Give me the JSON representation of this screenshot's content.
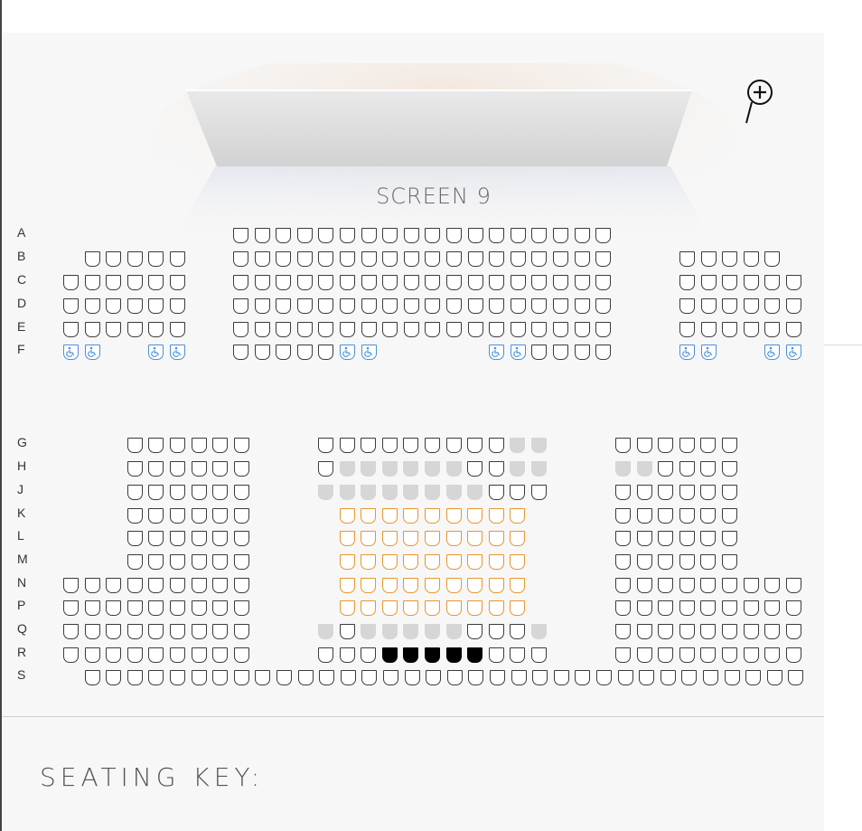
{
  "screen": {
    "label": "SCREEN 9"
  },
  "zoom": {
    "icon": "zoom-in-icon"
  },
  "seating_key": {
    "title": "SEATING KEY:"
  },
  "colors": {
    "available_border": "#3b3b3b",
    "sold": "#d6d6d6",
    "vip_border": "#e8962c",
    "selected": "#000000",
    "wheelchair": "#4a90d9"
  },
  "legend_states": [
    "available",
    "sold",
    "vip",
    "selected",
    "wheelchair"
  ],
  "rows": [
    {
      "label": "A",
      "blocks": [
        {
          "block": "center",
          "start": 0,
          "seats": "AAAAAAAAAAAAAAAAAA"
        }
      ]
    },
    {
      "label": "B",
      "blocks": [
        {
          "block": "left",
          "start": 1,
          "seats": "AAAAA"
        },
        {
          "block": "center",
          "start": 0,
          "seats": "AAAAAAAAAAAAAAAAAA"
        },
        {
          "block": "right",
          "start": 0,
          "seats": "AAAAA"
        }
      ]
    },
    {
      "label": "C",
      "blocks": [
        {
          "block": "left",
          "start": 0,
          "seats": "AAAAAA"
        },
        {
          "block": "center",
          "start": 0,
          "seats": "AAAAAAAAAAAAAAAAAA"
        },
        {
          "block": "right",
          "start": 0,
          "seats": "AAAAAA"
        }
      ]
    },
    {
      "label": "D",
      "blocks": [
        {
          "block": "left",
          "start": 0,
          "seats": "AAAAAA"
        },
        {
          "block": "center",
          "start": 0,
          "seats": "AAAAAAAAAAAAAAAAAA"
        },
        {
          "block": "right",
          "start": 0,
          "seats": "AAAAAA"
        }
      ]
    },
    {
      "label": "E",
      "blocks": [
        {
          "block": "left",
          "start": 0,
          "seats": "AAAAAA"
        },
        {
          "block": "center",
          "start": 0,
          "seats": "AAAAAAAAAAAAAAAAAA"
        },
        {
          "block": "right",
          "start": 0,
          "seats": "AAAAAA"
        }
      ]
    },
    {
      "label": "F",
      "blocks": [
        {
          "block": "left",
          "start": 0,
          "seats": "WW..WW"
        },
        {
          "block": "center",
          "start": 0,
          "seats": "AAAAAWW.....WWAAAA"
        },
        {
          "block": "right",
          "start": 0,
          "seats": "WW..WW"
        }
      ]
    },
    {
      "label": "G",
      "blocks": [
        {
          "block": "lower-left",
          "start": 3,
          "seats": "AAAAAA"
        },
        {
          "block": "lower-center",
          "start": 0,
          "seats": "AAAAAAAAASS"
        },
        {
          "block": "lower-right",
          "start": 0,
          "seats": "AAAAAA"
        }
      ]
    },
    {
      "label": "H",
      "blocks": [
        {
          "block": "lower-left",
          "start": 3,
          "seats": "AAAAAA"
        },
        {
          "block": "lower-center",
          "start": 0,
          "seats": "ASSSSSSAASS"
        },
        {
          "block": "lower-right",
          "start": 0,
          "seats": "SSAAAA"
        }
      ]
    },
    {
      "label": "J",
      "blocks": [
        {
          "block": "lower-left",
          "start": 3,
          "seats": "AAAAAA"
        },
        {
          "block": "lower-center",
          "start": 0,
          "seats": "SSSSSSSSAAA"
        },
        {
          "block": "lower-right",
          "start": 0,
          "seats": "AAAAAA"
        }
      ]
    },
    {
      "label": "K",
      "blocks": [
        {
          "block": "lower-left",
          "start": 3,
          "seats": "AAAAAA"
        },
        {
          "block": "lower-center",
          "start": 1,
          "seats": "VVVVVVVVV"
        },
        {
          "block": "lower-right",
          "start": 0,
          "seats": "AAAAAA"
        }
      ]
    },
    {
      "label": "L",
      "blocks": [
        {
          "block": "lower-left",
          "start": 3,
          "seats": "AAAAAA"
        },
        {
          "block": "lower-center",
          "start": 1,
          "seats": "VVVVVVVVV"
        },
        {
          "block": "lower-right",
          "start": 0,
          "seats": "AAAAAA"
        }
      ]
    },
    {
      "label": "M",
      "blocks": [
        {
          "block": "lower-left",
          "start": 3,
          "seats": "AAAAAA"
        },
        {
          "block": "lower-center",
          "start": 1,
          "seats": "VVVVVVVVV"
        },
        {
          "block": "lower-right",
          "start": 0,
          "seats": "AAAAAA"
        }
      ]
    },
    {
      "label": "N",
      "blocks": [
        {
          "block": "lower-left",
          "start": 0,
          "seats": "AAAAAAAAA"
        },
        {
          "block": "lower-center",
          "start": 1,
          "seats": "VVVVVVVVV"
        },
        {
          "block": "lower-right",
          "start": 0,
          "seats": "AAAAAAAAA"
        }
      ]
    },
    {
      "label": "P",
      "blocks": [
        {
          "block": "lower-left",
          "start": 0,
          "seats": "AAAAAAAAA"
        },
        {
          "block": "lower-center",
          "start": 1,
          "seats": "VVVVVVVVV"
        },
        {
          "block": "lower-right",
          "start": 0,
          "seats": "AAAAAAAAA"
        }
      ]
    },
    {
      "label": "Q",
      "blocks": [
        {
          "block": "lower-left",
          "start": 0,
          "seats": "AAAAAAAAA"
        },
        {
          "block": "lower-center",
          "start": 0,
          "seats": "SASSSSSAAAS"
        },
        {
          "block": "lower-right",
          "start": 0,
          "seats": "AAAAAAAAA"
        }
      ]
    },
    {
      "label": "R",
      "blocks": [
        {
          "block": "lower-left",
          "start": 0,
          "seats": "AAAAAAAAA"
        },
        {
          "block": "lower-center",
          "start": 0,
          "seats": "AAAXXXXXAAA"
        },
        {
          "block": "lower-right",
          "start": 0,
          "seats": "AAAAAAAAA"
        }
      ]
    },
    {
      "label": "S",
      "blocks": [
        {
          "block": "full",
          "start": 1,
          "seats": "AAAAAAAAAAAAAAAAAAAAAAAAAAAAAAAAAA"
        }
      ]
    }
  ]
}
